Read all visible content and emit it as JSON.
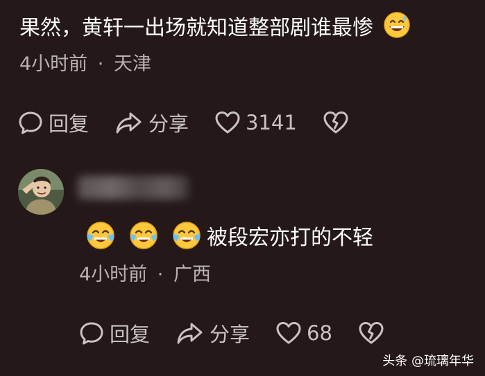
{
  "comment": {
    "text": "果然，黄轩一出场就知道整部剧谁最惨",
    "emoji_icon": "grinning-sweat-face-icon",
    "time": "4小时前",
    "separator": "·",
    "location": "天津",
    "actions": {
      "reply_label": "回复",
      "share_label": "分享",
      "like_count": "3141"
    }
  },
  "reply": {
    "avatar_icon": "saluting-man-avatar",
    "emojis": [
      "crying-laughing-face-icon",
      "crying-laughing-face-icon",
      "crying-laughing-face-icon"
    ],
    "text": "被段宏亦打的不轻",
    "time": "4小时前",
    "separator": "·",
    "location": "广西",
    "actions": {
      "reply_label": "回复",
      "share_label": "分享",
      "like_count": "68"
    }
  },
  "watermark": {
    "text": "头条 @琉璃年华"
  },
  "colors": {
    "background": "#241818",
    "text_primary": "#ffffff",
    "text_secondary": "#b9b2b2"
  }
}
